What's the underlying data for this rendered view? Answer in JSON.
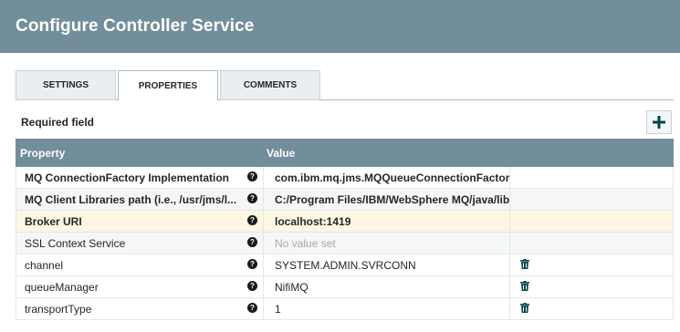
{
  "dialog": {
    "title": "Configure Controller Service"
  },
  "tabs": [
    {
      "label": "SETTINGS",
      "active": false
    },
    {
      "label": "PROPERTIES",
      "active": true
    },
    {
      "label": "COMMENTS",
      "active": false
    }
  ],
  "required_label": "Required field",
  "add_property_icon": "plus-icon",
  "grid": {
    "headers": {
      "property": "Property",
      "value": "Value"
    },
    "rows": [
      {
        "property": "MQ ConnectionFactory Implementation",
        "value": "com.ibm.mq.jms.MQQueueConnectionFactory",
        "required": true,
        "deletable": false
      },
      {
        "property": "MQ Client Libraries path (i.e., /usr/jms/l...",
        "value": "C:/Program Files/IBM/WebSphere MQ/java/lib",
        "required": true,
        "deletable": false
      },
      {
        "property": "Broker URI",
        "value": "localhost:1419",
        "required": true,
        "deletable": false,
        "selected": true
      },
      {
        "property": "SSL Context Service",
        "value": "No value set",
        "required": false,
        "deletable": false,
        "empty": true
      },
      {
        "property": "channel",
        "value": "SYSTEM.ADMIN.SVRCONN",
        "required": false,
        "deletable": true
      },
      {
        "property": "queueManager",
        "value": "NifiMQ",
        "required": false,
        "deletable": true
      },
      {
        "property": "transportType",
        "value": "1",
        "required": false,
        "deletable": true
      }
    ]
  },
  "colors": {
    "header_bg": "#728e9b",
    "selected_row_bg": "#fcf6e2"
  }
}
